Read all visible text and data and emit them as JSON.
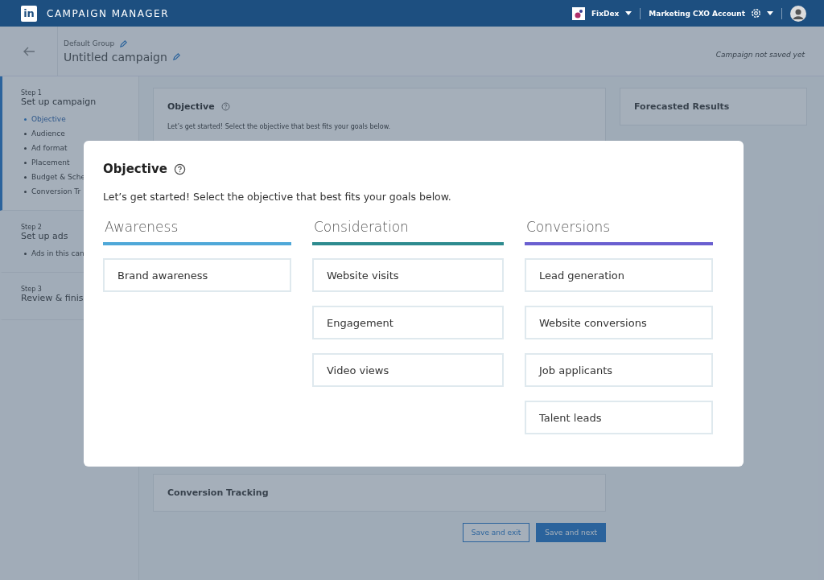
{
  "topbar": {
    "brand": "CAMPAIGN MANAGER",
    "logo": "in",
    "account": "FixDex",
    "account_name": "Marketing CXO Account"
  },
  "header": {
    "group": "Default Group",
    "campaign": "Untitled campaign",
    "save_status": "Campaign not saved yet"
  },
  "steps": [
    {
      "step": "Step 1",
      "title": "Set up campaign",
      "active": true,
      "items": [
        {
          "label": "Objective",
          "selected": true
        },
        {
          "label": "Audience",
          "selected": false
        },
        {
          "label": "Ad format",
          "selected": false
        },
        {
          "label": "Placement",
          "selected": false
        },
        {
          "label": "Budget & Sche",
          "selected": false
        },
        {
          "label": "Conversion Tr",
          "selected": false
        }
      ]
    },
    {
      "step": "Step 2",
      "title": "Set up ads",
      "active": false,
      "items": [
        {
          "label": "Ads in this can",
          "selected": false
        }
      ]
    },
    {
      "step": "Step 3",
      "title": "Review & finis",
      "active": false
    }
  ],
  "background_card": {
    "title": "Objective",
    "subtitle": "Let’s get started! Select the objective that best fits your goals below."
  },
  "forecast": {
    "title": "Forecasted Results"
  },
  "conversion_tracking": {
    "title": "Conversion Tracking"
  },
  "buttons": [
    {
      "label": "Save and exit",
      "kind": "secondary"
    },
    {
      "label": "Save and next",
      "kind": "primary"
    }
  ],
  "modal": {
    "title": "Objective",
    "subtitle": "Let’s get started! Select the objective that best fits your goals below.",
    "columns": [
      {
        "heading": "Awareness",
        "color": "#4fa8d8",
        "options": [
          "Brand awareness"
        ]
      },
      {
        "heading": "Consideration",
        "color": "#2e8b8f",
        "options": [
          "Website visits",
          "Engagement",
          "Video views"
        ]
      },
      {
        "heading": "Conversions",
        "color": "#6a5fd0",
        "options": [
          "Lead generation",
          "Website conversions",
          "Job applicants",
          "Talent leads"
        ]
      }
    ]
  }
}
